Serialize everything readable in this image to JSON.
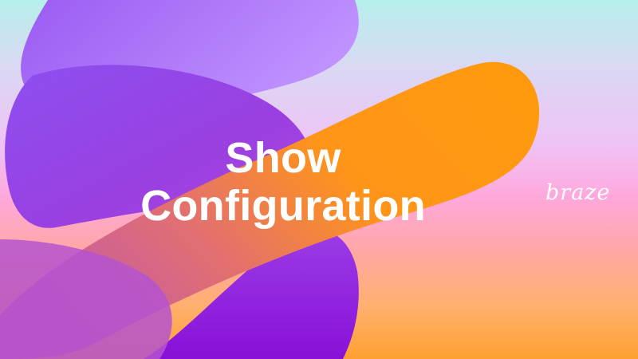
{
  "slide": {
    "title_line1": "Show",
    "title_line2": "Configuration"
  },
  "brand": {
    "logo_text": "braze"
  },
  "colors": {
    "background_top": "#b5f0ec",
    "background_middle": "#ffa8dc",
    "background_bottom": "#ffa030",
    "ribbon_purple": "#8a2be2",
    "ribbon_orange": "#ff9a0f",
    "title_text": "#ffffff"
  }
}
